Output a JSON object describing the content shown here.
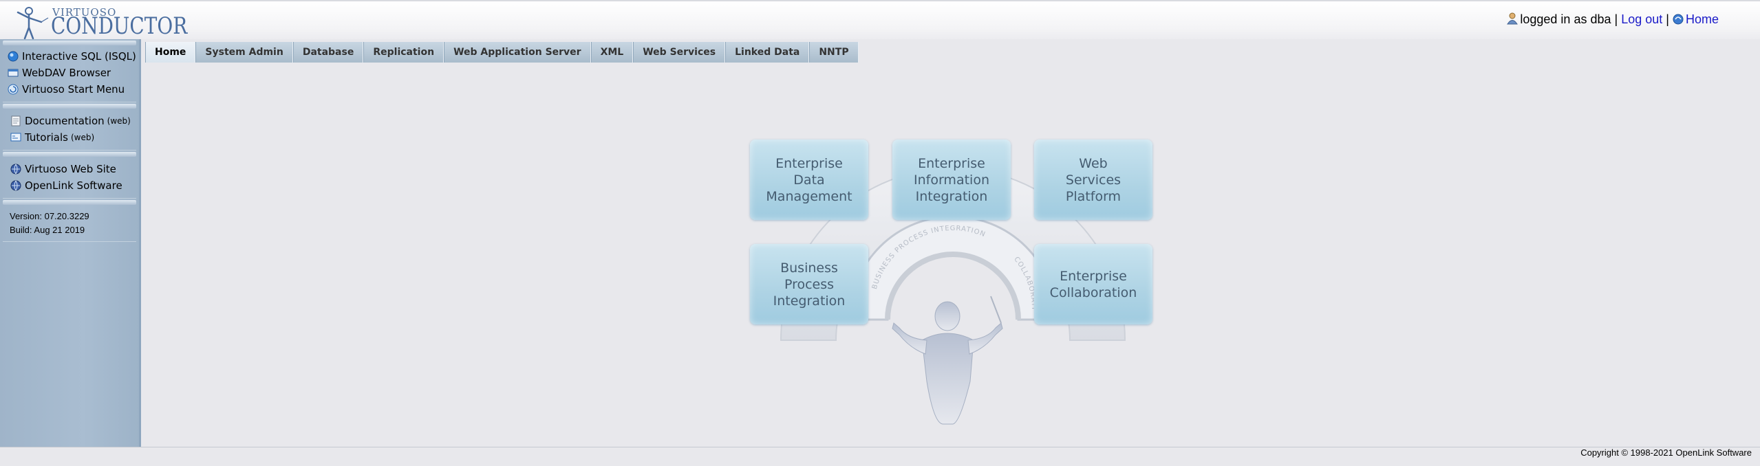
{
  "header": {
    "logo": {
      "top": "VIRTUOSO",
      "main": "CONDUCTOR"
    },
    "user": {
      "status": "logged in as dba",
      "sep": "|",
      "logout": "Log out",
      "home": "Home"
    }
  },
  "sidebar": {
    "tools": [
      {
        "label": "Interactive SQL (ISQL)",
        "icon": "sql-icon"
      },
      {
        "label": "WebDAV Browser",
        "icon": "folder-icon"
      },
      {
        "label": "Virtuoso Start Menu",
        "icon": "start-menu-icon"
      }
    ],
    "docs": [
      {
        "label": "Documentation",
        "suffix": "(web)",
        "icon": "document-icon"
      },
      {
        "label": "Tutorials",
        "suffix": "(web)",
        "icon": "tutorial-icon"
      }
    ],
    "links": [
      {
        "label": "Virtuoso Web Site",
        "icon": "globe-icon"
      },
      {
        "label": "OpenLink Software",
        "icon": "globe-icon"
      }
    ],
    "version": "Version: 07.20.3229",
    "build": "Build: Aug 21 2019"
  },
  "tabs": [
    "Home",
    "System Admin",
    "Database",
    "Replication",
    "Web Application Server",
    "XML",
    "Web Services",
    "Linked Data",
    "NNTP"
  ],
  "diagram": {
    "boxes": [
      "Enterprise\nData\nManagement",
      "Enterprise\nInformation\nIntegration",
      "Web\nServices\nPlatform",
      "Business\nProcess\nIntegration",
      "Enterprise\nCollaboration"
    ],
    "arc_labels": [
      "BUSINESS PROCESS INTEGRATION",
      "COLLABORATION"
    ]
  },
  "footer": {
    "copyright": "Copyright © 1998-2021 OpenLink Software"
  },
  "colors": {
    "sidebar": "#a9bdd1",
    "tab": "#b8c9d8",
    "box": "#aed3e4",
    "link": "#1a1ac8"
  }
}
